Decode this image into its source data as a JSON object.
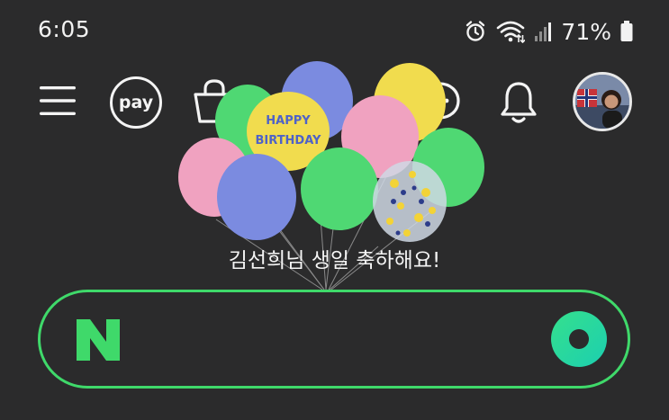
{
  "status_bar": {
    "time": "6:05",
    "battery_percent": "71%",
    "icons": [
      "alarm-icon",
      "wifi-icon",
      "signal-icon",
      "battery-icon"
    ]
  },
  "topbar": {
    "pay_label": "pay",
    "icons": [
      "menu-icon",
      "pay-icon",
      "shopping-bag-icon",
      "chat-icon",
      "bell-icon",
      "avatar"
    ]
  },
  "banner": {
    "balloon_text_line1": "HAPPY",
    "balloon_text_line2": "BIRTHDAY",
    "message": "김선희님 생일 축하해요!"
  },
  "search": {
    "logo_letter": "N",
    "logo_color": "#3fd96a",
    "border_color": "#3fd96a",
    "green_dot_icon": "greendot-icon"
  },
  "colors": {
    "background": "#2b2b2c",
    "accent": "#3fd96a"
  }
}
